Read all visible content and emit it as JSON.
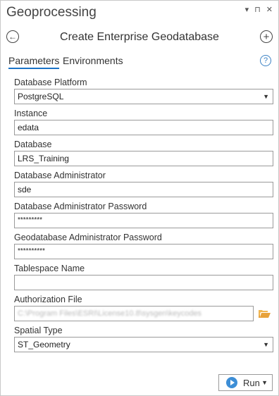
{
  "pane": {
    "title": "Geoprocessing",
    "controls": {
      "dropdown": "▾",
      "pin": "⊓",
      "close": "✕"
    }
  },
  "tool": {
    "title": "Create Enterprise Geodatabase",
    "back_icon": "back-arrow-icon",
    "add_icon": "add-plus-icon"
  },
  "tabs": {
    "parameters": "Parameters",
    "environments": "Environments",
    "help": "?"
  },
  "params": {
    "db_platform": {
      "label": "Database Platform",
      "value": "PostgreSQL"
    },
    "instance": {
      "label": "Instance",
      "value": "edata"
    },
    "database": {
      "label": "Database",
      "value": "LRS_Training"
    },
    "db_admin": {
      "label": "Database Administrator",
      "value": "sde"
    },
    "db_admin_pw": {
      "label": "Database Administrator Password",
      "value": "*********"
    },
    "gdb_admin_pw": {
      "label": "Geodatabase Administrator Password",
      "value": "**********"
    },
    "tablespace": {
      "label": "Tablespace Name",
      "value": ""
    },
    "auth_file": {
      "label": "Authorization File",
      "value": "C:\\Program Files\\ESRI\\License10.8\\sysgen\\keycodes"
    },
    "spatial_type": {
      "label": "Spatial Type",
      "value": "ST_Geometry"
    }
  },
  "run": {
    "label": "Run"
  },
  "colors": {
    "accent": "#1a73c7",
    "run_icon": "#3d8ed6",
    "folder": "#e8a23b"
  }
}
